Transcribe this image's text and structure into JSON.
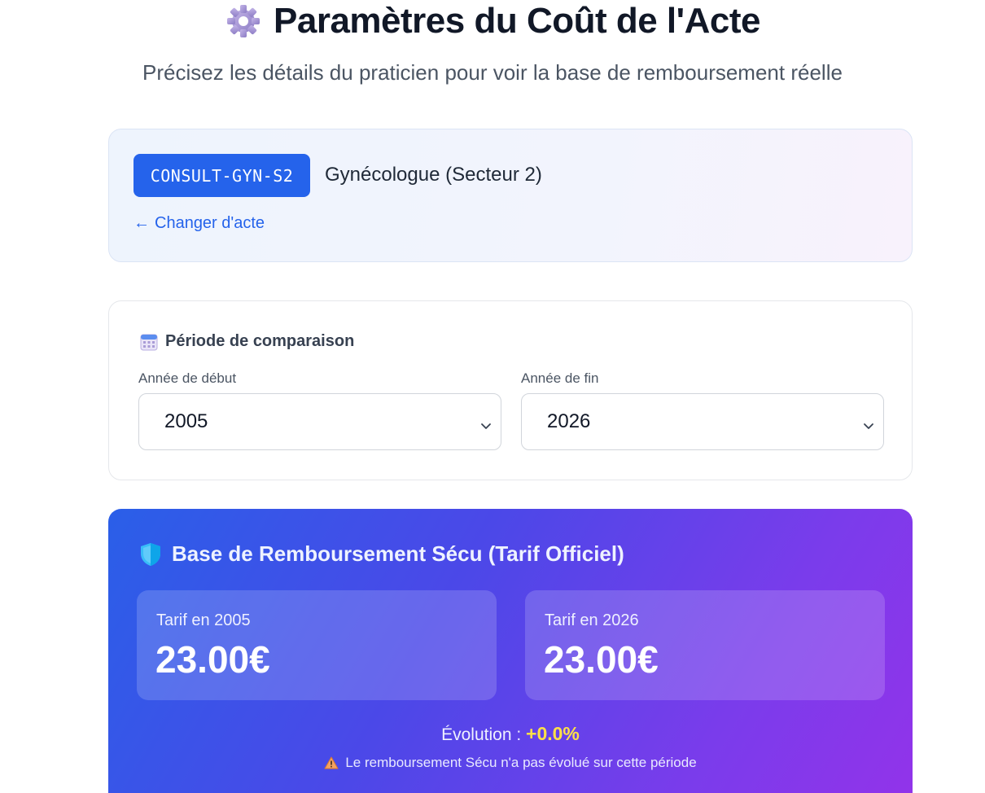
{
  "header": {
    "title": "Paramètres du Coût de l'Acte",
    "subtitle": "Précisez les détails du praticien pour voir la base de remboursement réelle",
    "icon": "gear-icon"
  },
  "act": {
    "code": "CONSULT-GYN-S2",
    "label": "Gynécologue (Secteur 2)",
    "change_link": "Changer d'acte",
    "change_arrow": "←"
  },
  "period": {
    "icon": "calendar-icon",
    "title": "Période de comparaison",
    "start_label": "Année de début",
    "start_value": "2005",
    "end_label": "Année de fin",
    "end_value": "2026"
  },
  "base": {
    "icon": "shield-icon",
    "title": "Base de Remboursement Sécu (Tarif Officiel)",
    "start_label": "Tarif en 2005",
    "start_value": "23.00€",
    "end_label": "Tarif en 2026",
    "end_value": "23.00€",
    "evolution_label": "Évolution :",
    "evolution_value": "+0.0%",
    "warning_icon": "warning-icon",
    "warning_text": "Le remboursement Sécu n'a pas évolué sur cette période"
  },
  "colors": {
    "accent": "#2563eb",
    "gradient_start": "#2a5fe8",
    "gradient_end": "#9333ea",
    "evolution": "#fde047"
  }
}
